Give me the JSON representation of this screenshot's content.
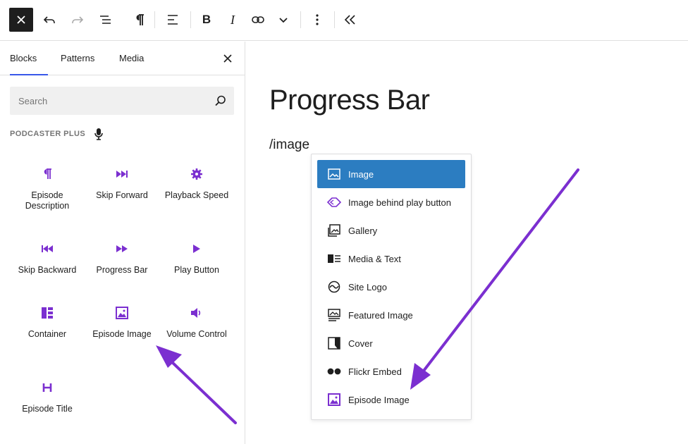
{
  "colors": {
    "accent": "#3858e9",
    "block_icon": "#7b2fd0",
    "arrow": "#7b2fd0",
    "selected": "#2c7dc1"
  },
  "toolbar": {
    "icons": [
      "close-icon",
      "undo-icon",
      "redo-icon",
      "list-view-icon",
      "paragraph-icon",
      "align-left-icon",
      "bold-icon",
      "italic-icon",
      "link-icon",
      "chevron-down-icon",
      "more-vertical-icon",
      "collapse-icon"
    ]
  },
  "sidebar": {
    "tabs": [
      {
        "label": "Blocks"
      },
      {
        "label": "Patterns"
      },
      {
        "label": "Media"
      }
    ],
    "search_placeholder": "Search",
    "category": "PODCASTER PLUS",
    "blocks": [
      {
        "label": "Episode Description",
        "icon": "pilcrow-icon"
      },
      {
        "label": "Skip Forward",
        "icon": "skip-forward-icon"
      },
      {
        "label": "Playback Speed",
        "icon": "gear-icon"
      },
      {
        "label": "Skip Backward",
        "icon": "skip-backward-icon"
      },
      {
        "label": "Progress Bar",
        "icon": "fast-forward-icon"
      },
      {
        "label": "Play Button",
        "icon": "play-icon"
      },
      {
        "label": "Container",
        "icon": "container-icon"
      },
      {
        "label": "Episode Image",
        "icon": "image-icon"
      },
      {
        "label": "Volume Control",
        "icon": "volume-icon"
      },
      {
        "label": "Episode Title",
        "icon": "heading-icon"
      }
    ]
  },
  "main": {
    "title": "Progress Bar",
    "slash_text": "/image"
  },
  "popup": {
    "items": [
      {
        "label": "Image",
        "icon": "image-icon",
        "selected": true
      },
      {
        "label": "Image behind play button",
        "icon": "diamond-icon"
      },
      {
        "label": "Gallery",
        "icon": "gallery-icon"
      },
      {
        "label": "Media & Text",
        "icon": "media-text-icon"
      },
      {
        "label": "Site Logo",
        "icon": "site-logo-icon"
      },
      {
        "label": "Featured Image",
        "icon": "featured-image-icon"
      },
      {
        "label": "Cover",
        "icon": "cover-icon"
      },
      {
        "label": "Flickr Embed",
        "icon": "flickr-icon"
      },
      {
        "label": "Episode Image",
        "icon": "episode-image-icon"
      }
    ]
  }
}
